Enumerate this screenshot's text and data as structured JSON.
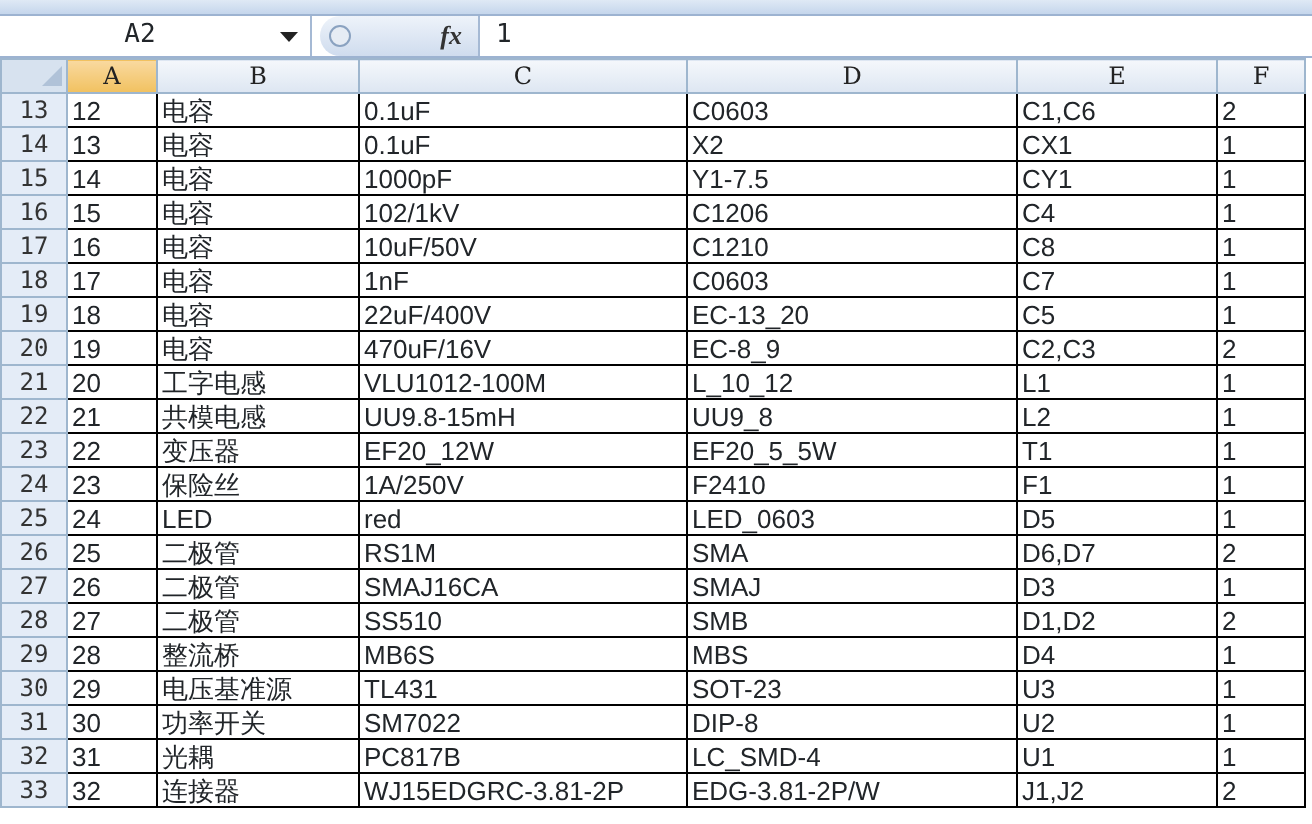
{
  "formula_bar": {
    "name_box": "A2",
    "function_label": "fx",
    "value": "1"
  },
  "columns": [
    {
      "label": "A",
      "selected": true
    },
    {
      "label": "B",
      "selected": false
    },
    {
      "label": "C",
      "selected": false
    },
    {
      "label": "D",
      "selected": false
    },
    {
      "label": "E",
      "selected": false
    },
    {
      "label": "F",
      "selected": false
    }
  ],
  "rows": [
    {
      "number": "13",
      "cells": [
        "12",
        "电容",
        "0.1uF",
        "C0603",
        "C1,C6",
        "2"
      ]
    },
    {
      "number": "14",
      "cells": [
        "13",
        "电容",
        "0.1uF",
        "X2",
        "CX1",
        "1"
      ]
    },
    {
      "number": "15",
      "cells": [
        "14",
        "电容",
        "1000pF",
        "Y1-7.5",
        "CY1",
        "1"
      ]
    },
    {
      "number": "16",
      "cells": [
        "15",
        "电容",
        "102/1kV",
        "C1206",
        "C4",
        "1"
      ]
    },
    {
      "number": "17",
      "cells": [
        "16",
        "电容",
        "10uF/50V",
        "C1210",
        "C8",
        "1"
      ]
    },
    {
      "number": "18",
      "cells": [
        "17",
        "电容",
        "1nF",
        "C0603",
        "C7",
        "1"
      ]
    },
    {
      "number": "19",
      "cells": [
        "18",
        "电容",
        "22uF/400V",
        "EC-13_20",
        "C5",
        "1"
      ]
    },
    {
      "number": "20",
      "cells": [
        "19",
        "电容",
        "470uF/16V",
        "EC-8_9",
        "C2,C3",
        "2"
      ]
    },
    {
      "number": "21",
      "cells": [
        "20",
        "工字电感",
        "VLU1012-100M",
        "L_10_12",
        "L1",
        "1"
      ]
    },
    {
      "number": "22",
      "cells": [
        "21",
        "共模电感",
        "UU9.8-15mH",
        "UU9_8",
        "L2",
        "1"
      ]
    },
    {
      "number": "23",
      "cells": [
        "22",
        "变压器",
        "EF20_12W",
        "EF20_5_5W",
        "T1",
        "1"
      ]
    },
    {
      "number": "24",
      "cells": [
        "23",
        "保险丝",
        "1A/250V",
        "F2410",
        "F1",
        "1"
      ]
    },
    {
      "number": "25",
      "cells": [
        "24",
        "LED",
        "red",
        "LED_0603",
        "D5",
        "1"
      ]
    },
    {
      "number": "26",
      "cells": [
        "25",
        "二极管",
        "RS1M",
        "SMA",
        "D6,D7",
        "2"
      ]
    },
    {
      "number": "27",
      "cells": [
        "26",
        "二极管",
        "SMAJ16CA",
        "SMAJ",
        "D3",
        "1"
      ]
    },
    {
      "number": "28",
      "cells": [
        "27",
        "二极管",
        "SS510",
        "SMB",
        "D1,D2",
        "2"
      ]
    },
    {
      "number": "29",
      "cells": [
        "28",
        "整流桥",
        "MB6S",
        "MBS",
        "D4",
        "1"
      ]
    },
    {
      "number": "30",
      "cells": [
        "29",
        "电压基准源",
        "TL431",
        "SOT-23",
        "U3",
        "1"
      ]
    },
    {
      "number": "31",
      "cells": [
        "30",
        "功率开关",
        "SM7022",
        "DIP-8",
        "U2",
        "1"
      ]
    },
    {
      "number": "32",
      "cells": [
        "31",
        "光耦",
        "PC817B",
        "LC_SMD-4",
        "U1",
        "1"
      ]
    },
    {
      "number": "33",
      "cells": [
        "32",
        "连接器",
        "WJ15EDGRC-3.81-2P",
        "EDG-3.81-2P/W",
        "J1,J2",
        "2"
      ]
    }
  ]
}
